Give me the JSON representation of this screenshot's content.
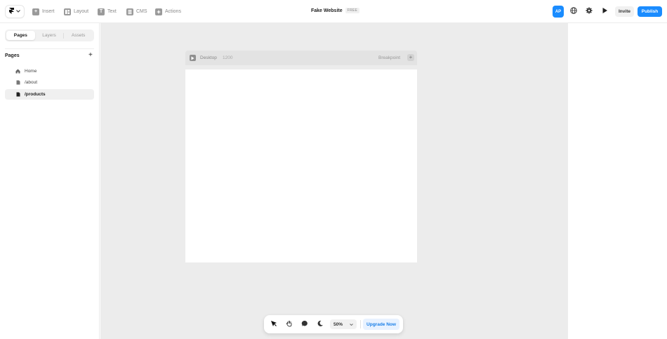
{
  "toolbar": {
    "logo_icon": "framer-logo-icon",
    "items": [
      {
        "label": "Insert",
        "icon": "plus-square-icon"
      },
      {
        "label": "Layout",
        "icon": "layout-icon"
      },
      {
        "label": "Text",
        "icon": "text-icon"
      },
      {
        "label": "CMS",
        "icon": "database-icon"
      },
      {
        "label": "Actions",
        "icon": "sparkle-icon"
      }
    ],
    "project_title": "Fake Website",
    "plan_badge": "FREE",
    "avatar_initials": "AP",
    "invite_label": "Invite",
    "publish_label": "Publish",
    "accent_color": "#1a8cff"
  },
  "left_panel": {
    "tabs": [
      {
        "label": "Pages",
        "active": true
      },
      {
        "label": "Layers",
        "active": false
      },
      {
        "label": "Assets",
        "active": false
      }
    ],
    "pages_heading": "Pages",
    "add_symbol": "+",
    "pages": [
      {
        "label": "Home",
        "icon": "home-icon",
        "active": false
      },
      {
        "label": "/about",
        "icon": "file-icon",
        "active": false
      },
      {
        "label": "/products",
        "icon": "file-icon",
        "active": true
      }
    ]
  },
  "canvas": {
    "frame_label": "Desktop",
    "frame_width": "1200",
    "breakpoint_label": "Breakpoint",
    "breakpoint_add": "+",
    "background": "#ececec"
  },
  "bottom_toolbar": {
    "tools": [
      "select-arrow-icon",
      "hand-icon",
      "comment-icon",
      "dark-mode-icon"
    ],
    "zoom": "50%",
    "upgrade_label": "Upgrade Now"
  }
}
